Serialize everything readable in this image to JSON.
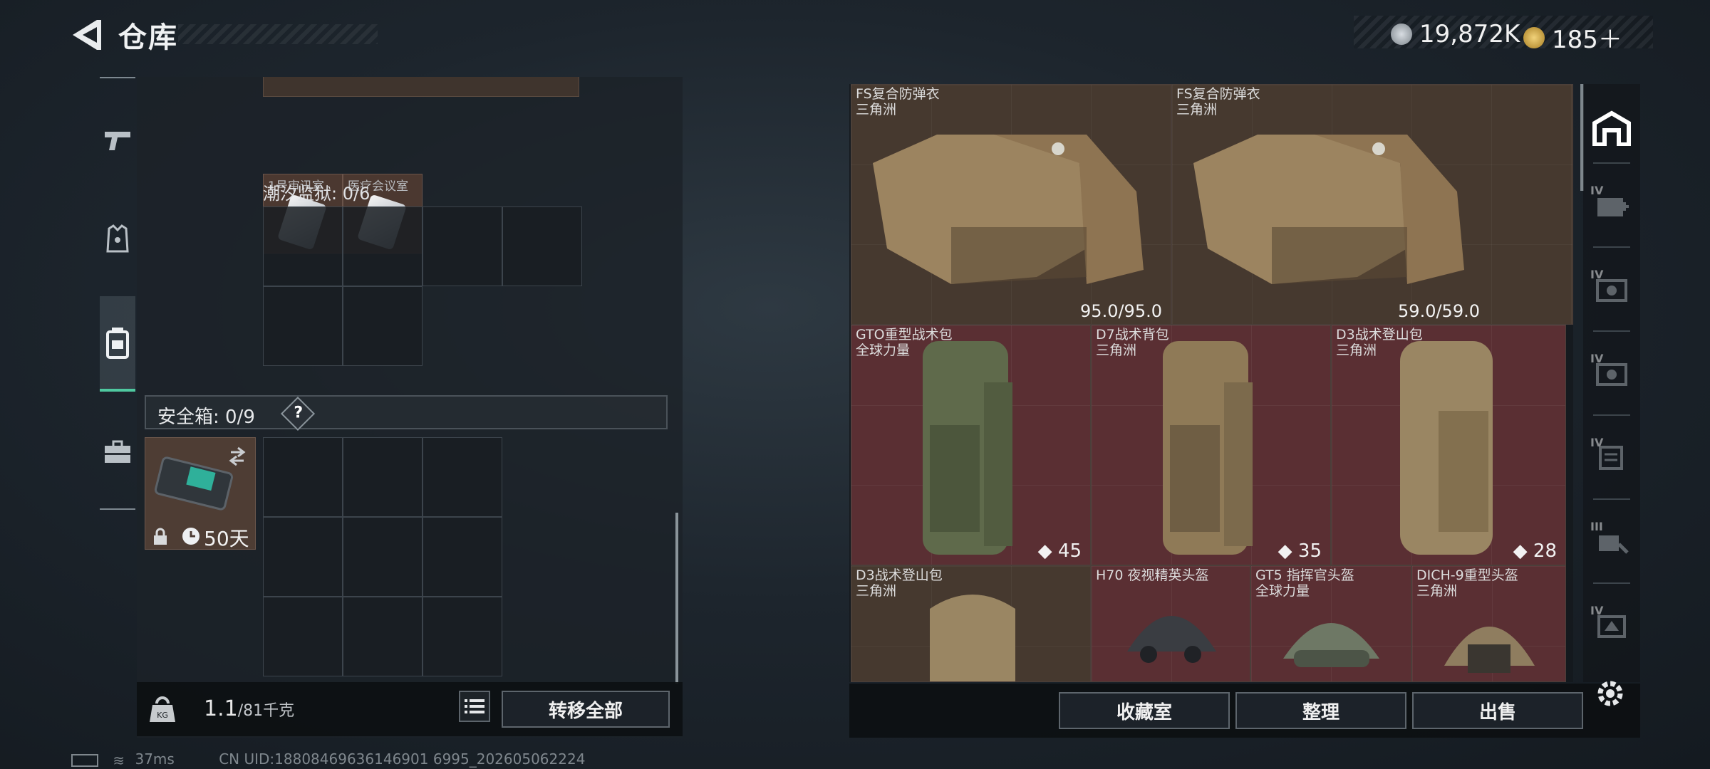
{
  "header": {
    "title": "仓库",
    "currency_silver": "19,872K",
    "currency_gold": "185＋"
  },
  "left": {
    "item_a_label": "1号审讯室",
    "item_b_label": "医疗会议室",
    "tidal_label": "潮汐监狱: 0/6",
    "safe_label": "安全箱: 0/9",
    "safe_help": "?",
    "safe_timer": "50天",
    "weight_value": "1.1",
    "weight_max": "/81千克",
    "transfer_all": "转移全部"
  },
  "right": {
    "items": [
      {
        "name": "FS复合防弹衣",
        "sub": "三角洲",
        "value": "95.0/95.0"
      },
      {
        "name": "FS复合防弹衣",
        "sub": "三角洲",
        "value": "59.0/59.0"
      },
      {
        "name": "GTO重型战术包",
        "sub": "全球力量",
        "value": "45"
      },
      {
        "name": "D7战术背包",
        "sub": "三角洲",
        "value": "35"
      },
      {
        "name": "D3战术登山包",
        "sub": "三角洲",
        "value": "28"
      },
      {
        "name": "D3战术登山包",
        "sub": "三角洲",
        "value": ""
      },
      {
        "name": "H70 夜视精英头盔",
        "sub": "",
        "value": ""
      },
      {
        "name": "GT5 指挥官头盔",
        "sub": "全球力量",
        "value": ""
      },
      {
        "name": "DICH-9重型头盔",
        "sub": "三角洲",
        "value": ""
      }
    ],
    "buttons": {
      "collection": "收藏室",
      "organize": "整理",
      "sell": "出售"
    }
  },
  "filter_labels": [
    "IV",
    "IV",
    "IV",
    "IV",
    "III",
    "IV"
  ],
  "status": {
    "ping": "37ms",
    "uid": "CN UID:18808469636146901 6995_202605062224"
  },
  "colors": {
    "accent": "#4fc9a0",
    "item_red": "#5a2f33",
    "item_brown": "#46392f"
  }
}
